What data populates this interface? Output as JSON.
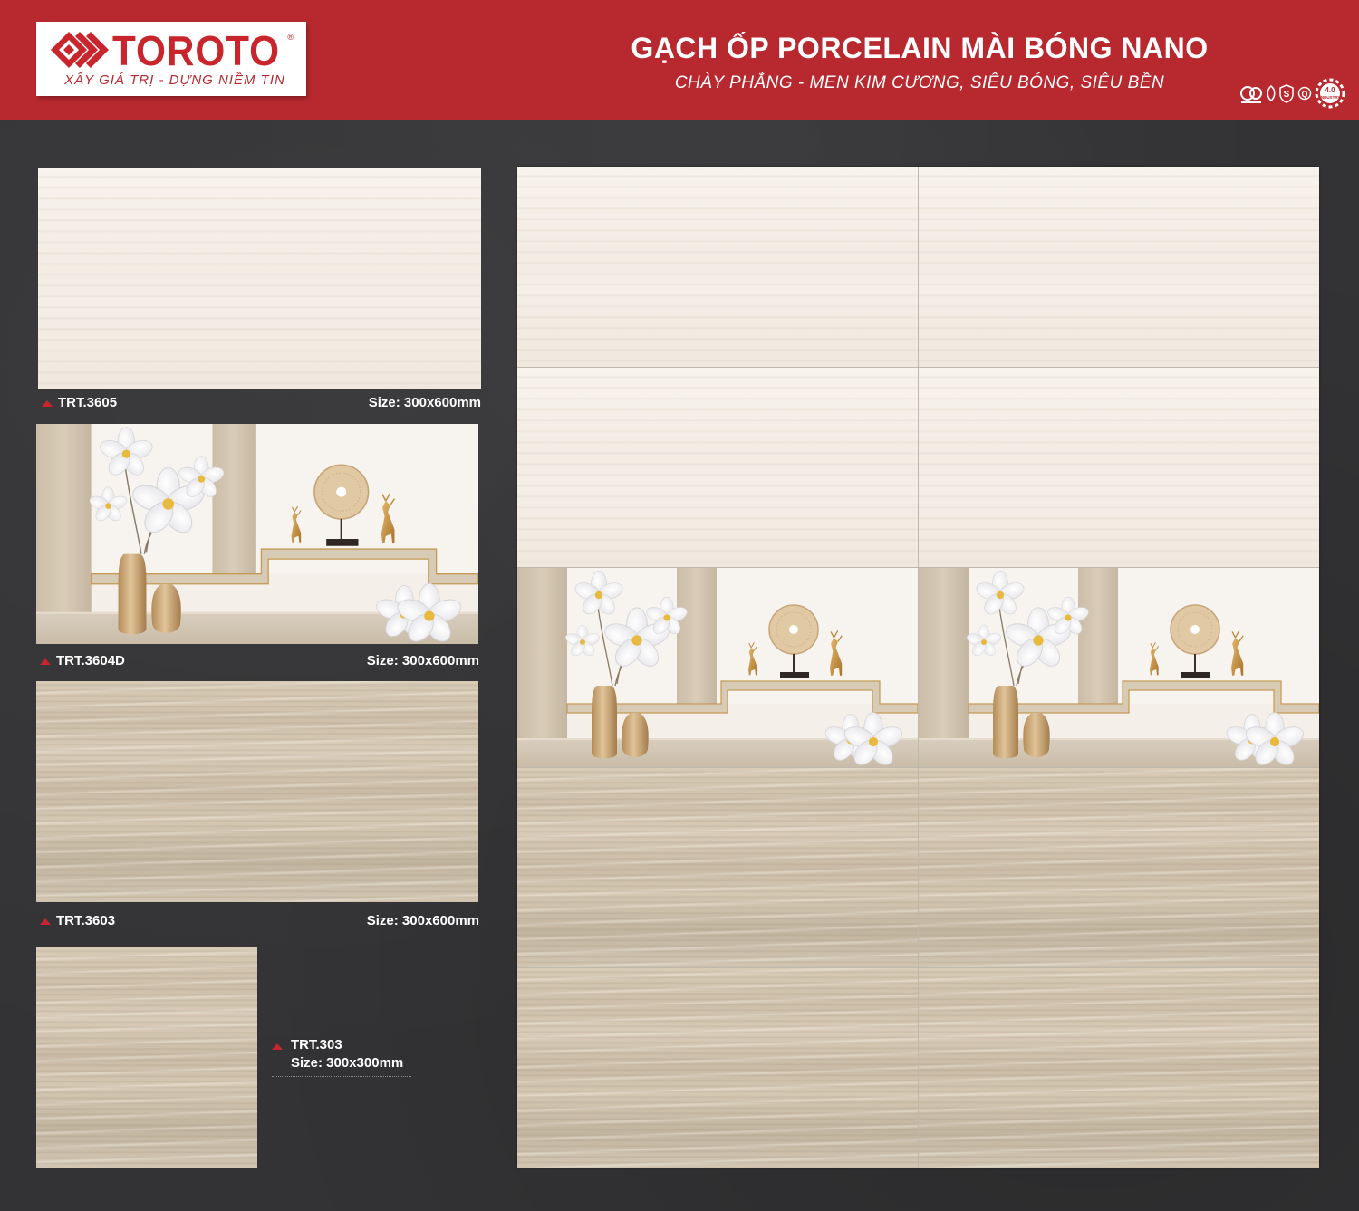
{
  "brand": {
    "name": "TOROTO",
    "registered": "®",
    "tagline": "XÂY GIÁ TRỊ - DỰNG NIỀM TIN",
    "logo_icon": "diamond-chevron-logo-icon",
    "brand_color": "#b8282f"
  },
  "header": {
    "title": "GẠCH ỐP PORCELAIN MÀI BÓNG NANO",
    "subtitle": "CHÀY PHẲNG - MEN KIM CƯƠNG, SIÊU BÓNG, SIÊU BỀN",
    "cert_icons": [
      "cert-circle-icon",
      "cert-leaf-icon",
      "cert-shield-s-icon",
      "cert-q-icon",
      "industry-4-gear-icon"
    ],
    "industry_badge": "4.0",
    "industry_text": "INDUSTRY"
  },
  "products": [
    {
      "code": "TRT.3605",
      "size": "Size: 300x600mm",
      "style": "plain-white"
    },
    {
      "code": "TRT.3604D",
      "size": "Size: 300x600mm",
      "style": "decor"
    },
    {
      "code": "TRT.3603",
      "size": "Size: 300x600mm",
      "style": "wood"
    },
    {
      "code": "TRT.303",
      "size": "Size: 300x300mm",
      "style": "wood-floor"
    }
  ]
}
